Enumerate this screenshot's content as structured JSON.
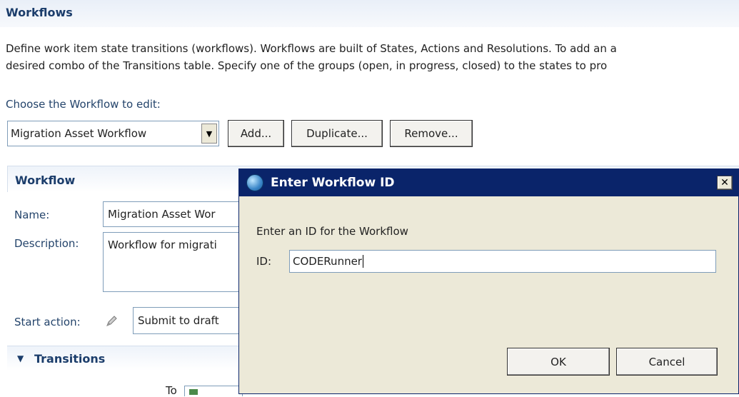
{
  "page": {
    "title": "Workflows",
    "description_line1": "Define work item state transitions (workflows). Workflows are built of States, Actions and Resolutions. To add an a",
    "description_line2": " desired combo of the Transitions table. Specify one of the groups (open, in progress, closed) to the states to pro",
    "choose_label": "Choose the Workflow to edit:",
    "selected_workflow": "Migration Asset Workflow",
    "buttons": {
      "add": "Add...",
      "duplicate": "Duplicate...",
      "remove": "Remove..."
    }
  },
  "workflow_section": {
    "title": "Workflow",
    "name_label": "Name:",
    "name_value": "Migration Asset Wor",
    "description_label": "Description:",
    "description_value": "Workflow for migrati",
    "start_action_label": "Start action:",
    "start_action_value": "Submit to draft"
  },
  "transitions": {
    "title": "Transitions",
    "to_label": "To"
  },
  "dialog": {
    "title": "Enter Workflow ID",
    "message": "Enter an ID for the Workflow",
    "id_label": "ID:",
    "id_value": "CODERunner",
    "ok": "OK",
    "cancel": "Cancel"
  }
}
